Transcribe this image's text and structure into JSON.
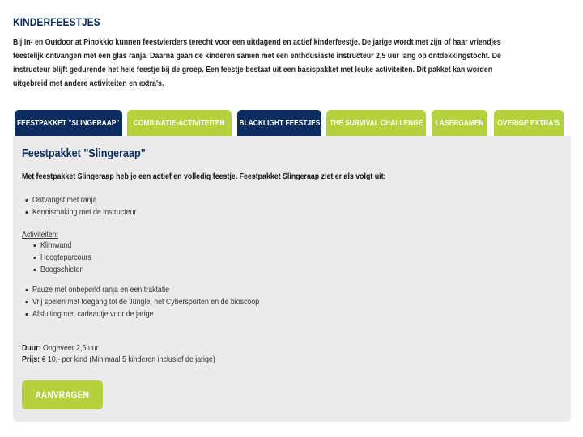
{
  "title": "KINDERFEESTJES",
  "intro_lines": [
    "Bij In- en Outdoor at Pinokkio kunnen feestvierders terecht voor een uitdagend en actief kinderfeestje. De jarige wordt met zijn of haar vriendjes",
    "feestelijk ontvangen met een glas ranja. Daarna gaan de kinderen samen met een enthousiaste instructeur 2,5 uur lang op ontdekkingstocht. De",
    "instructeur blijft gedurende het hele feestje bij de groep. Een feestje bestaat uit een basispakket met leuke activiteiten. Dit pakket kan worden",
    "uitgebreid met andere activiteiten en extra's."
  ],
  "tabs": [
    {
      "label": "FEESTPAKKET \"SLINGERAAP\"",
      "color": "#0b2c5f",
      "active": true
    },
    {
      "label": "COMBINATIE-ACTIVITEITEN",
      "color": "#b3d23c"
    },
    {
      "label": "BLACKLIGHT FEESTJES",
      "color": "#0b2c5f"
    },
    {
      "label": "THE SURVIVAL CHALLENGE",
      "color": "#b3d23c"
    },
    {
      "label": "LASERGAMEN",
      "color": "#b3d23c"
    },
    {
      "label": "OVERIGE EXTRA'S",
      "color": "#b3d23c"
    }
  ],
  "panel": {
    "heading": "Feestpakket \"Slingeraap\"",
    "lead": "Met feestpakket Slingeraap heb je een actief en volledig feestje. Feestpakket Slingeraap ziet er als volgt uit:",
    "list1": [
      "Ontvangst met ranja",
      "Kennismaking met de instructeur"
    ],
    "activities_label": "Activiteiten:",
    "activities": [
      "Klimwand",
      "Hoogteparcours",
      "Boogschieten"
    ],
    "list2": [
      "Pauze met onbeperkt ranja en een traktatie",
      "Vrij spelen met toegang tot de Jungle, het Cybersporten en de bioscoop",
      "Afsluiting met cadeautje voor de jarige"
    ],
    "duration_label": "Duur:",
    "duration": "Ongeveer 2,5 uur",
    "price_label": "Prijs:",
    "price": "€ 10,- per kind (Minimaal 5 kinderen inclusief de jarige)",
    "button": "AANVRAGEN"
  }
}
